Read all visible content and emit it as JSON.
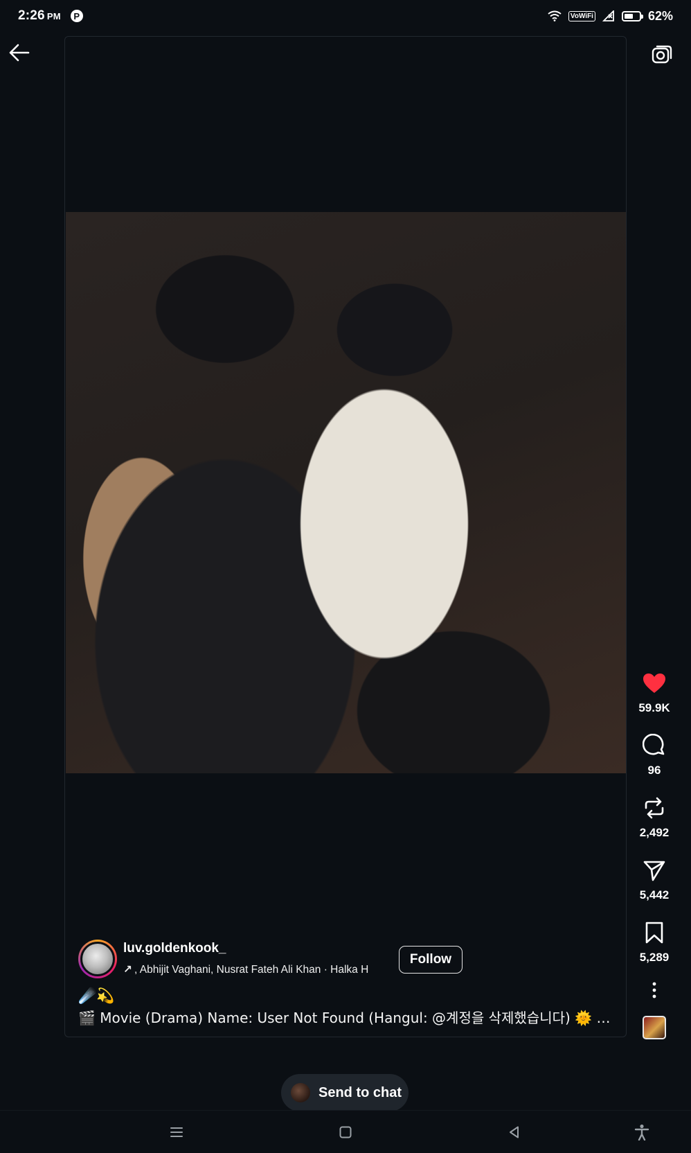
{
  "status_bar": {
    "time": "2:26",
    "ampm": "PM",
    "pinterest_glyph": "P",
    "vowifi_label": "VoWiFi",
    "battery_percent": "62%",
    "battery_level": 0.62
  },
  "post": {
    "username": "luv.goldenkook_",
    "music_arrow": "↗",
    "music_text": ", Abhijit Vaghani, Nusrat Fateh Ali Khan · Halka H",
    "follow_label": "Follow",
    "emoji_line": "☄️💫",
    "caption": "🎬 Movie (Drama) Name: User Not Found (Hangul: @계정을 삭제했습니다) 🌞 Genre: ..."
  },
  "actions": {
    "likes": "59.9K",
    "comments": "96",
    "reposts": "2,492",
    "shares": "5,442",
    "saves": "5,289"
  },
  "send_to_chat": {
    "label": "Send to chat"
  },
  "colors": {
    "background": "#0b0f14",
    "like_red": "#ff3040",
    "text": "#ffffff"
  },
  "icons": [
    "back-arrow-icon",
    "camera-icon",
    "heart-icon",
    "comment-icon",
    "repost-icon",
    "share-icon",
    "bookmark-icon",
    "more-icon",
    "menu-icon",
    "home-square-icon",
    "back-triangle-icon",
    "accessibility-icon"
  ]
}
